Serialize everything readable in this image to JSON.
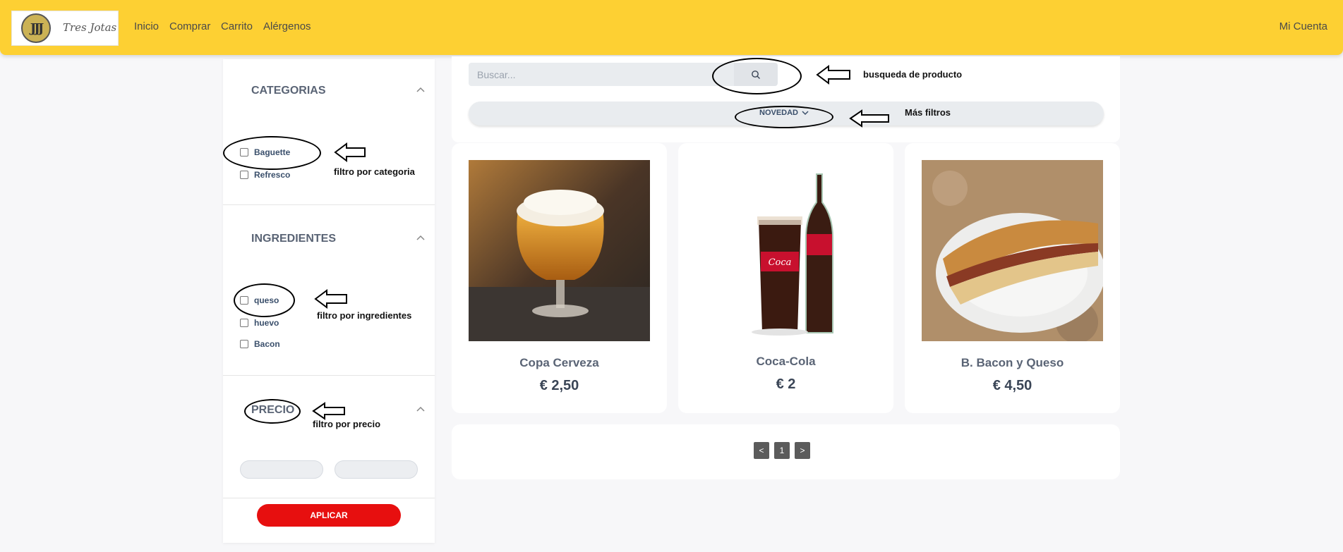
{
  "header": {
    "logo_text": "Tres Jotas",
    "logo_mark": "JJJ",
    "nav": [
      "Inicio",
      "Comprar",
      "Carrito",
      "Alérgenos"
    ],
    "account": "Mi Cuenta",
    "bg_color": "#fdd033"
  },
  "sidebar": {
    "categories": {
      "title": "CATEGORIAS",
      "items": [
        "Baguette",
        "Refresco"
      ]
    },
    "ingredients": {
      "title": "INGREDIENTES",
      "items": [
        "queso",
        "huevo",
        "Bacon"
      ]
    },
    "price": {
      "title": "PRECIO"
    },
    "apply_label": "APLICAR",
    "apply_color": "#e70f0f"
  },
  "search": {
    "placeholder": "Buscar...",
    "filter_label": "NOVEDAD"
  },
  "products": [
    {
      "name": "Copa Cerveza",
      "price": "€ 2,50"
    },
    {
      "name": "Coca-Cola",
      "price": "€ 2"
    },
    {
      "name": "B. Bacon y Queso",
      "price": "€ 4,50"
    }
  ],
  "pagination": {
    "prev": "<",
    "page": "1",
    "next": ">"
  },
  "annotations": {
    "search": "busqueda de producto",
    "filters": "Más filtros",
    "category": "filtro por categoria",
    "ingredients": "filtro por ingredientes",
    "price": "filtro por precio"
  }
}
